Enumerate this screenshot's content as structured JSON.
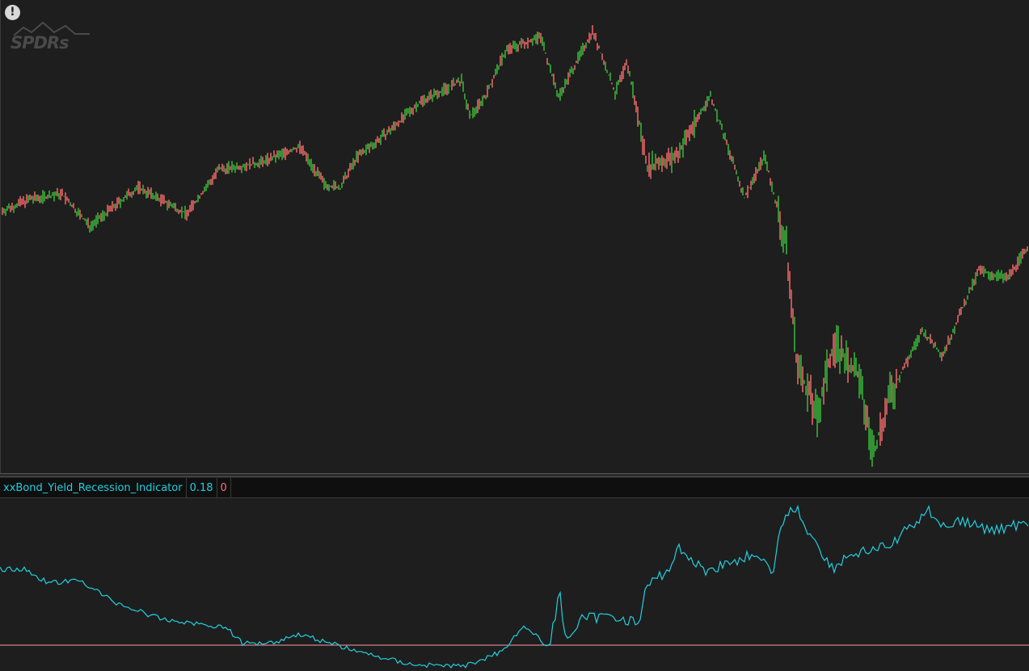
{
  "watermark": {
    "logo_text": "SPDRs",
    "logo_icon": "chart-mountain-logo"
  },
  "alert": {
    "icon": "exclamation-icon",
    "symbol": "!"
  },
  "indicator": {
    "name": "xxBond_Yield_Recession_Indicator",
    "value": "0.18",
    "zero_value": "0"
  },
  "colors": {
    "background": "#1e1e1e",
    "up_bar": "#3cc43c",
    "down_bar": "#ff6f6f",
    "indicator_line": "#20d0e0",
    "zero_line": "#ff9aa8",
    "header_bg": "#0f0f0f"
  }
}
